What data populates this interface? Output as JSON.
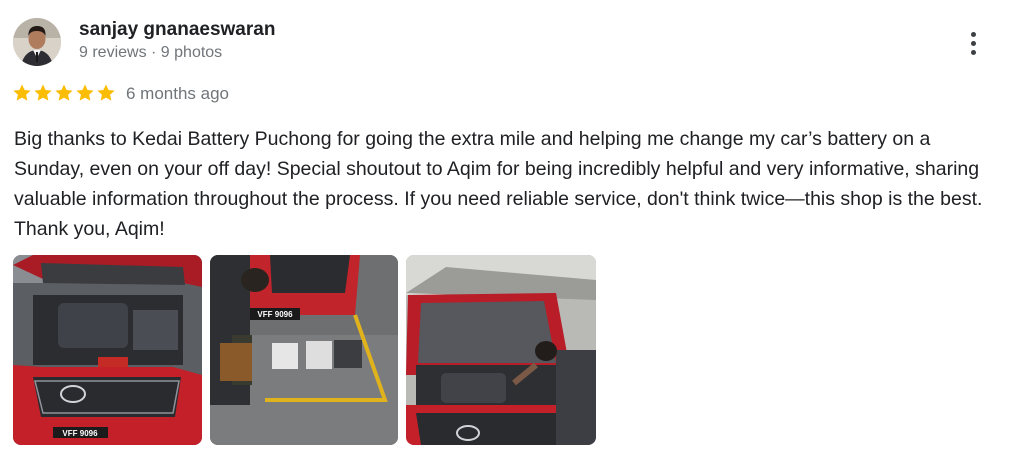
{
  "review": {
    "author_name": "sanjay gnanaeswaran",
    "author_meta": "9 reviews · 9 photos",
    "rating": 5,
    "rating_max": 5,
    "time_ago": "6 months ago",
    "text": "Big thanks to Kedai Battery Puchong for going the extra mile and helping me change my car’s battery on a Sunday, even on your off day! Special shoutout to Aqim for being incredibly helpful and very informative, sharing valuable information throughout the process. If you need reliable service, don't think twice—this shop is the best. Thank you, Aqim!",
    "photos": [
      {
        "plate": "VFF 9096"
      },
      {
        "plate": "VFF 9096"
      },
      {
        "plate": ""
      }
    ]
  },
  "icons": {
    "menu": "more-vert-icon",
    "star": "star-icon"
  },
  "colors": {
    "star": "#fbbc04",
    "name": "#202124",
    "meta": "#70757a",
    "car_red": "#c4202a"
  }
}
